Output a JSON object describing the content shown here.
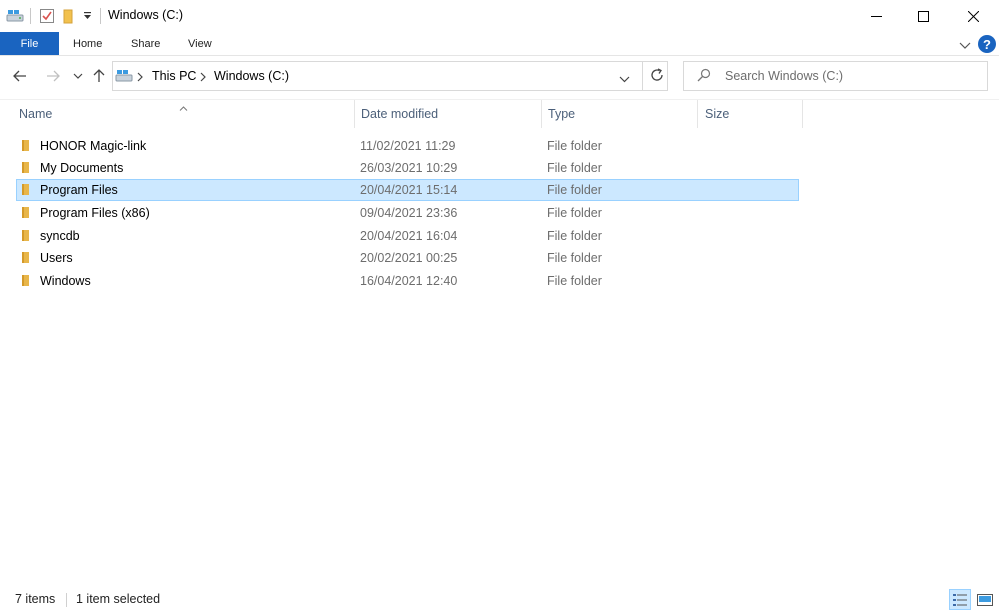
{
  "window": {
    "title": "Windows (C:)"
  },
  "ribbon": {
    "tabs": [
      "File",
      "Home",
      "Share",
      "View"
    ]
  },
  "address": {
    "segments": [
      "This PC",
      "Windows (C:)"
    ]
  },
  "search": {
    "placeholder": "Search Windows (C:)"
  },
  "columns": [
    "Name",
    "Date modified",
    "Type",
    "Size"
  ],
  "files": [
    {
      "name": "HONOR Magic-link",
      "date": "11/02/2021 11:29",
      "type": "File folder",
      "selected": false
    },
    {
      "name": "My Documents",
      "date": "26/03/2021 10:29",
      "type": "File folder",
      "selected": false
    },
    {
      "name": "Program Files",
      "date": "20/04/2021 15:14",
      "type": "File folder",
      "selected": true
    },
    {
      "name": "Program Files (x86)",
      "date": "09/04/2021 23:36",
      "type": "File folder",
      "selected": false
    },
    {
      "name": "syncdb",
      "date": "20/04/2021 16:04",
      "type": "File folder",
      "selected": false
    },
    {
      "name": "Users",
      "date": "20/02/2021 00:25",
      "type": "File folder",
      "selected": false
    },
    {
      "name": "Windows",
      "date": "16/04/2021 12:40",
      "type": "File folder",
      "selected": false
    }
  ],
  "status": {
    "item_count": "7 items",
    "selection": "1 item selected"
  },
  "colors": {
    "accent": "#1a64c0",
    "selection_fill": "#cce8ff",
    "selection_border": "#99d1ff",
    "folder": "#e8b64a"
  }
}
